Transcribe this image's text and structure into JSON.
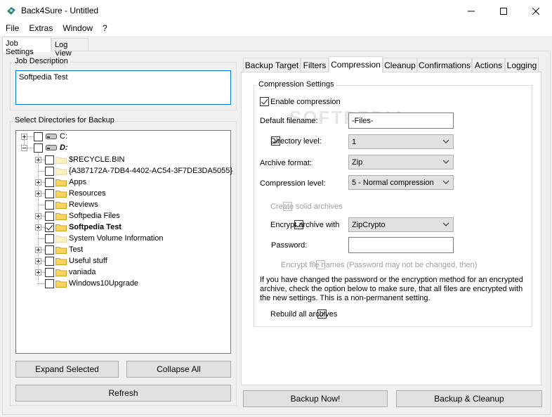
{
  "window": {
    "title": "Back4Sure - Untitled"
  },
  "menu": [
    "File",
    "Extras",
    "Window",
    "?"
  ],
  "outer_tabs": [
    "Job Settings",
    "Log View"
  ],
  "job_description": {
    "group_title": "Job Description",
    "value": "Softpedia Test"
  },
  "directories": {
    "group_title": "Select Directories for Backup",
    "drives": [
      {
        "label": "C:",
        "expanded": false,
        "checked": false
      },
      {
        "label": "D:",
        "expanded": true,
        "checked": false
      }
    ],
    "items": [
      {
        "label": "$RECYCLE.BIN",
        "checked": false,
        "expandable": true,
        "bold": false,
        "folder": "hidden"
      },
      {
        "label": "{A387172A-7DB4-4402-AC54-3F7DE3DA5055}",
        "checked": false,
        "expandable": false,
        "bold": false,
        "folder": "hidden"
      },
      {
        "label": "Apps",
        "checked": false,
        "expandable": true,
        "bold": false,
        "folder": "normal"
      },
      {
        "label": "Resources",
        "checked": false,
        "expandable": true,
        "bold": false,
        "folder": "normal"
      },
      {
        "label": "Reviews",
        "checked": false,
        "expandable": false,
        "bold": false,
        "folder": "normal"
      },
      {
        "label": "Softpedia Files",
        "checked": false,
        "expandable": true,
        "bold": false,
        "folder": "normal"
      },
      {
        "label": "Softpedia Test",
        "checked": true,
        "expandable": true,
        "bold": true,
        "folder": "normal"
      },
      {
        "label": "System Volume Information",
        "checked": false,
        "expandable": false,
        "bold": false,
        "folder": "hidden"
      },
      {
        "label": "Test",
        "checked": false,
        "expandable": true,
        "bold": false,
        "folder": "normal"
      },
      {
        "label": "Useful stuff",
        "checked": false,
        "expandable": true,
        "bold": false,
        "folder": "normal"
      },
      {
        "label": "vaniada",
        "checked": false,
        "expandable": true,
        "bold": false,
        "folder": "normal"
      },
      {
        "label": "Windows10Upgrade",
        "checked": false,
        "expandable": false,
        "bold": false,
        "folder": "normal"
      }
    ]
  },
  "buttons": {
    "expand_selected": "Expand Selected",
    "collapse_all": "Collapse All",
    "refresh": "Refresh",
    "backup_now": "Backup Now!",
    "backup_cleanup": "Backup & Cleanup"
  },
  "inner_tabs": [
    "Backup Target",
    "Filters",
    "Compression",
    "Cleanup",
    "Confirmations",
    "Actions",
    "Logging"
  ],
  "compression": {
    "group_title": "Compression Settings",
    "enable_label": "Enable compression",
    "enable_checked": true,
    "default_filename_label": "Default filename:",
    "default_filename_value": "-Files-",
    "directory_level_label": "Directory level:",
    "directory_level_checked": true,
    "directory_level_value": "1",
    "archive_format_label": "Archive format:",
    "archive_format_value": "Zip",
    "compression_level_label": "Compression level:",
    "compression_level_value": "5 - Normal compression",
    "solid_label": "Create solid archives",
    "solid_checked": false,
    "encrypt_label": "Encrypt archive with",
    "encrypt_checked": true,
    "encrypt_value": "ZipCrypto",
    "password_label": "Password:",
    "password_value": "",
    "encrypt_names_label": "Encrypt file names (Password may not be changed, then)",
    "encrypt_names_checked": false,
    "note": "If you have changed the password or the encryption method for an encrypted archive, check the option below to make sure, that all files are encrypted with the new settings. This is a non-permanent setting.",
    "rebuild_label": "Rebuild all archives",
    "rebuild_checked": true
  },
  "watermark": "SOFTPEDIA",
  "colors": {
    "folder_yellow": "#f5d45c",
    "accent_blue": "#0078d7"
  }
}
